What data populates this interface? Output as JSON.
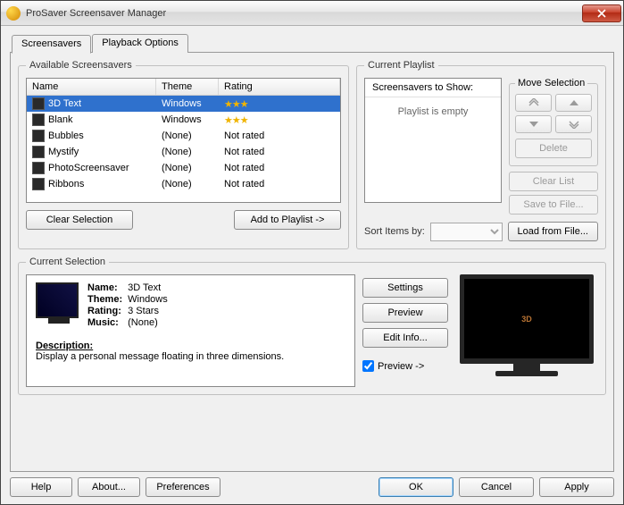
{
  "window": {
    "title": "ProSaver Screensaver Manager"
  },
  "tabs": {
    "screensavers": "Screensavers",
    "playback": "Playback Options"
  },
  "available": {
    "legend": "Available Screensavers",
    "columns": {
      "name": "Name",
      "theme": "Theme",
      "rating": "Rating"
    },
    "rows": [
      {
        "name": "3D Text",
        "theme": "Windows",
        "rating_stars": 3,
        "rating_text": "",
        "selected": true
      },
      {
        "name": "Blank",
        "theme": "Windows",
        "rating_stars": 3,
        "rating_text": "",
        "selected": false
      },
      {
        "name": "Bubbles",
        "theme": "(None)",
        "rating_stars": 0,
        "rating_text": "Not rated",
        "selected": false
      },
      {
        "name": "Mystify",
        "theme": "(None)",
        "rating_stars": 0,
        "rating_text": "Not rated",
        "selected": false
      },
      {
        "name": "PhotoScreensaver",
        "theme": "(None)",
        "rating_stars": 0,
        "rating_text": "Not rated",
        "selected": false
      },
      {
        "name": "Ribbons",
        "theme": "(None)",
        "rating_stars": 0,
        "rating_text": "Not rated",
        "selected": false
      }
    ],
    "clear_selection": "Clear Selection",
    "add_to_playlist": "Add to Playlist ->"
  },
  "playlist": {
    "legend": "Current Playlist",
    "header": "Screensavers to Show:",
    "empty": "Playlist is empty",
    "move_legend": "Move Selection",
    "delete": "Delete",
    "clear_list": "Clear List",
    "save_to_file": "Save to File...",
    "load_from_file": "Load from File...",
    "sort_label": "Sort Items by:"
  },
  "current": {
    "legend": "Current Selection",
    "labels": {
      "name": "Name:",
      "theme": "Theme:",
      "rating": "Rating:",
      "music": "Music:",
      "description": "Description:"
    },
    "values": {
      "name": "3D Text",
      "theme": "Windows",
      "rating": "3 Stars",
      "music": "(None)",
      "description": "Display a personal message floating in three dimensions."
    },
    "settings": "Settings",
    "preview": "Preview",
    "edit_info": "Edit Info...",
    "preview_check": "Preview ->",
    "preview_checked": true
  },
  "footer": {
    "help": "Help",
    "about": "About...",
    "preferences": "Preferences",
    "ok": "OK",
    "cancel": "Cancel",
    "apply": "Apply"
  }
}
